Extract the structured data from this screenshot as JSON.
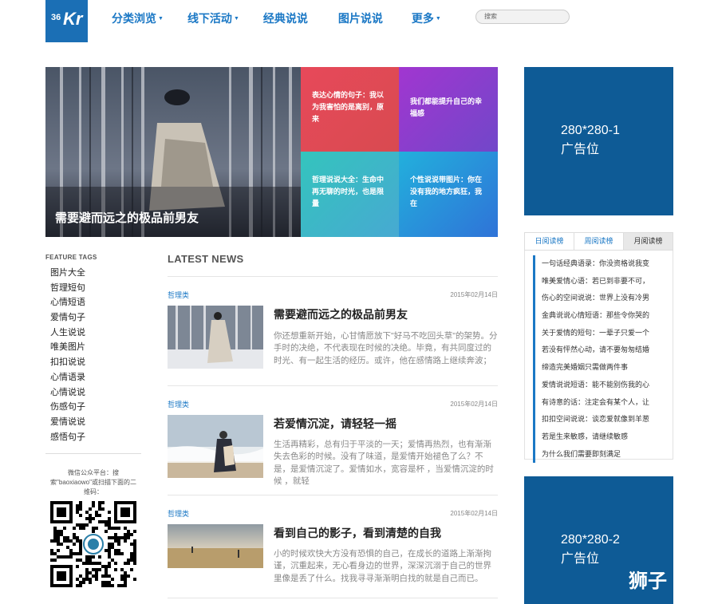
{
  "logo": {
    "num": "36",
    "letter": "Kr"
  },
  "nav": [
    {
      "label": "分类浏览",
      "caret": true
    },
    {
      "label": "线下活动",
      "caret": true
    },
    {
      "label": "经典说说",
      "caret": false
    },
    {
      "label": "图片说说",
      "caret": false
    },
    {
      "label": "更多",
      "caret": true
    }
  ],
  "search": {
    "placeholder": "搜索"
  },
  "hero": {
    "title": "需要避而远之的极品前男友"
  },
  "tiles": [
    {
      "text": "表达心情的句子：我以为我害怕的是离别，原来",
      "color": "#e04a55"
    },
    {
      "text": "我们都能提升自己的幸福感",
      "color": "#8b3fc9"
    },
    {
      "text": "哲理说说大全：生命中再无聊的时光，也是限量",
      "color": "#3cbcc0"
    },
    {
      "text": "个性说说带图片：你在没有我的地方疯狂，我在",
      "color": "#2b8bd6"
    }
  ],
  "ads": [
    {
      "line1": "280*280-1",
      "line2": "广告位"
    },
    {
      "line1": "280*280-2",
      "line2": "广告位"
    }
  ],
  "tabs": [
    "日阅读榜",
    "周阅读榜",
    "月阅读榜"
  ],
  "ranking": [
    "一句话经典语录：你没资格说我变",
    "唯美爱情心语：若已到非要不可，",
    "伤心的空间说说：世界上没有冷男",
    "金典说说心情短语：那些令你哭的",
    "关于爱情的短句：一辈子只爱一个",
    "若没有怦然心动，请不要匆匆结婚",
    "缔造完美婚姻只需做两件事",
    "爱情说说短语：能不能别伤我的心",
    "有诗意的话：注定会有某个人，让",
    "扣扣空间说说：谈恋爱就像到羊葱",
    "若是生来敏感，请继续敏感",
    "为什么我们需要即刻满足"
  ],
  "feature_tags": {
    "title": "FEATURE TAGS",
    "items": [
      "图片大全",
      "哲理短句",
      "心情短语",
      "爱情句子",
      "人生说说",
      "唯美图片",
      "扣扣说说",
      "心情语录",
      "心情说说",
      "伤感句子",
      "爱情说说",
      "感悟句子"
    ]
  },
  "wechat": {
    "text": "微信公众平台：搜索\"baoxiaowo\"或扫描下面的二维码："
  },
  "latest": {
    "title": "LATEST NEWS"
  },
  "news": [
    {
      "category": "哲理类",
      "date": "2015年02月14日",
      "title": "需要避而远之的极品前男友",
      "excerpt": "你还想重新开始，心甘情愿放下\"好马不吃回头草\"的架势。分手时的决绝，不代表现在时候的决绝。毕竟，有共同度过的时光、有一起生活的经历。或许，他在感情路上继续奔波；"
    },
    {
      "category": "哲理类",
      "date": "2015年02月14日",
      "title": "若爱情沉淀，请轻轻一摇",
      "excerpt": "生活再精彩，总有归于平淡的一天；爱情再热烈，也有渐渐失去色彩的时候。没有了味道，是爱情开始褪色了么？不是，是爱情沉淀了。爱情如水，宽容是杯 ，当爱情沉淀的时候 ，就轻"
    },
    {
      "category": "哲理类",
      "date": "2015年02月14日",
      "title": "看到自己的影子，看到清楚的自我",
      "excerpt": "小的时候欢快大方没有恐惧的自己，在成长的道路上渐渐拘谨，沉重起来，无心看身边的世界，深深沉溺于自己的世界里像是丢了什么。找我寻寻渐渐明白找的就是自己而已。"
    }
  ],
  "watermark": "狮子"
}
